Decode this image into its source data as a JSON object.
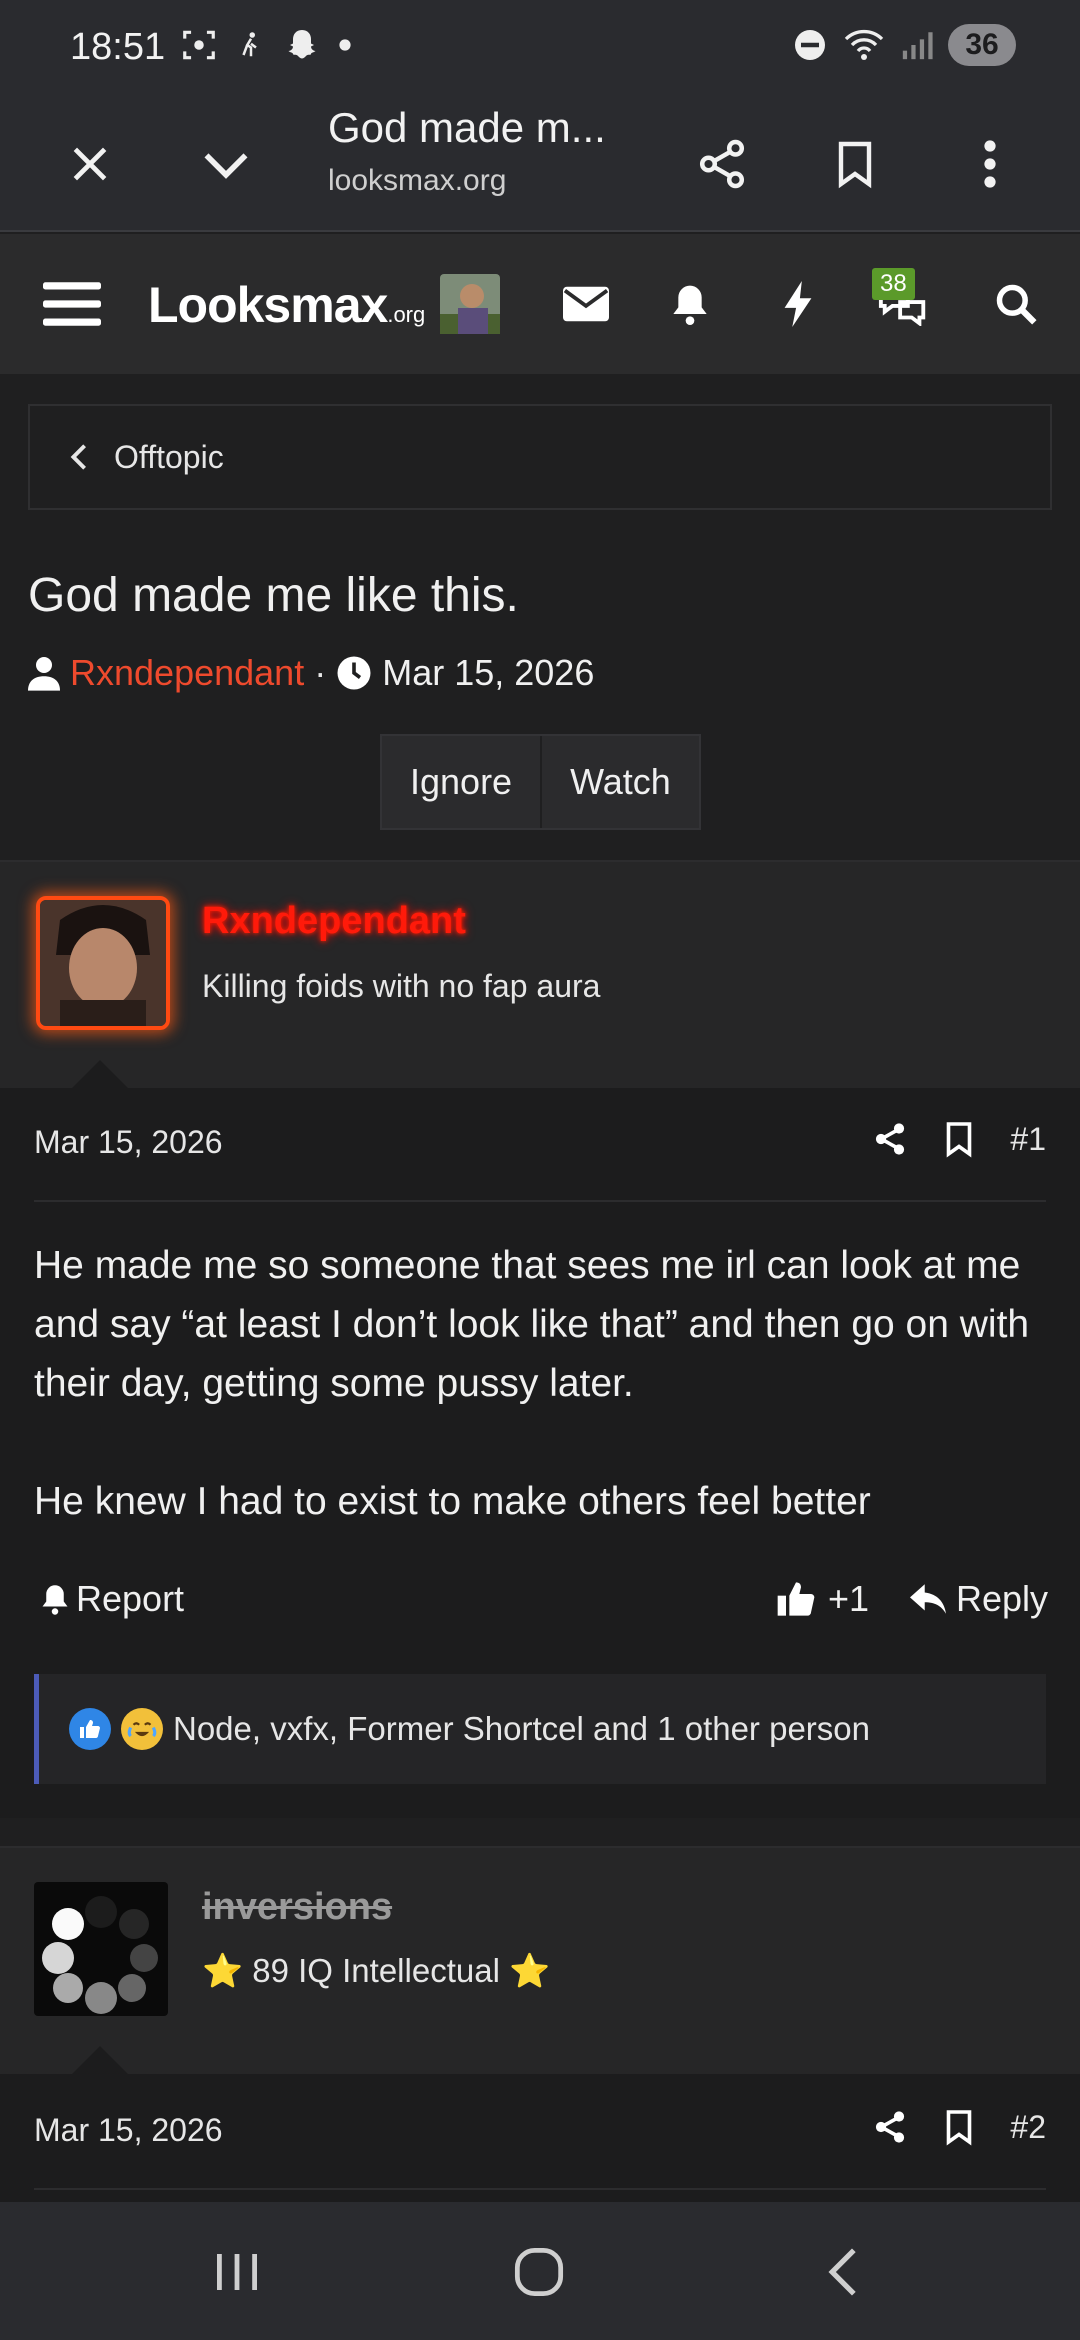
{
  "status_bar": {
    "time": "18:51",
    "battery": "36"
  },
  "browser": {
    "title": "God made m...",
    "url": "looksmax.org"
  },
  "site": {
    "logo_main": "Looksmax",
    "logo_suffix": ".org",
    "conversations_badge": "38"
  },
  "breadcrumb": {
    "label": "Offtopic"
  },
  "thread": {
    "title": "God made me like this.",
    "author": "Rxndependant",
    "separator": "·",
    "date": "Mar 15, 2026",
    "actions": [
      "Ignore",
      "Watch"
    ]
  },
  "posts": [
    {
      "username": "Rxndependant",
      "user_title": "Killing foids with no fap aura",
      "date": "Mar 15, 2026",
      "number": "#1",
      "paragraphs": [
        "He made me so someone that sees me irl can look at me and say “at least I don’t look like that” and then go on with their day, getting some pussy later.",
        "He knew I had to exist to make others feel better"
      ],
      "report_label": "Report",
      "like_count": "+1",
      "reply_label": "Reply",
      "reactions_text": "Node, vxfx, Former Shortcel and 1 other person"
    },
    {
      "username": "inversions",
      "user_title": "⭐ 89 IQ Intellectual ⭐",
      "date": "Mar 15, 2026",
      "number": "#2"
    }
  ],
  "colors": {
    "author_red": "#ee4a2d",
    "glow_red": "#ff1a0a",
    "reaction_bar": "#4c5bb8",
    "badge_green": "#5b9a2a"
  }
}
